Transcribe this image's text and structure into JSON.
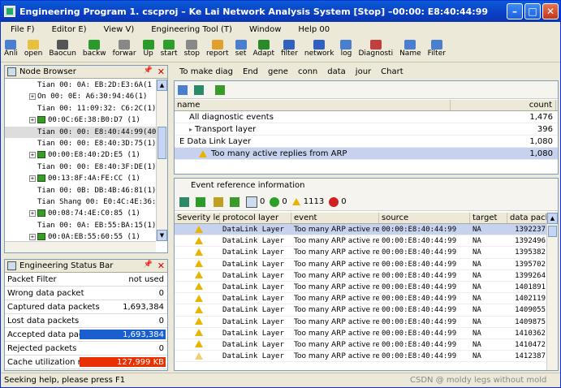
{
  "window": {
    "title": "Engineering Program 1. cscproj – Ke Lai Network Analysis System [Stop] –00:00: E8:40:44:99"
  },
  "menu": [
    "File F)",
    "Editor E)",
    "View V)",
    "Engineering Tool (T)",
    "Window",
    "Help 00"
  ],
  "toolbar": [
    {
      "label": "Anli",
      "color": "#4a7fd0"
    },
    {
      "label": "open",
      "color": "#e8c040"
    },
    {
      "label": "Baocun",
      "color": "#555"
    },
    {
      "label": "backw",
      "color": "#2a9a2a"
    },
    {
      "label": "forwar",
      "color": "#888"
    },
    {
      "label": "Up",
      "color": "#2a9a2a"
    },
    {
      "label": "start",
      "color": "#2aa02a"
    },
    {
      "label": "stop",
      "color": "#888"
    },
    {
      "label": "report",
      "color": "#e0a030"
    },
    {
      "label": "set",
      "color": "#4a7fd0"
    },
    {
      "label": "Adapt",
      "color": "#2a8a2a"
    },
    {
      "label": "filter",
      "color": "#3060c0"
    },
    {
      "label": "network",
      "color": "#3060c0"
    },
    {
      "label": "log",
      "color": "#4a7fd0"
    },
    {
      "label": "Diagnosti",
      "color": "#c04040"
    },
    {
      "label": "Name",
      "color": "#4a7fd0"
    },
    {
      "label": "Filter",
      "color": "#4a7fd0"
    }
  ],
  "node_browser": {
    "title": "Node Browser",
    "nodes": [
      {
        "text": "Tian 00: 0A: EB:2D:E3:6A(1",
        "icon": false,
        "exp": false
      },
      {
        "text": "On 00: 0E: A6:30:94:46(1)",
        "icon": false,
        "exp": true
      },
      {
        "text": "Tian 00: 11:09:32: C6:2C(1)",
        "icon": false,
        "exp": false
      },
      {
        "text": "00:0C:6E:38:B0:D7 (1)",
        "icon": true,
        "exp": true
      },
      {
        "text": "Tian 00: 00: E8:40:44:99(40)",
        "icon": false,
        "exp": false,
        "sel": true
      },
      {
        "text": "Tian 00: 00: E8:40:3D:75(1)",
        "icon": false,
        "exp": false
      },
      {
        "text": "00:00:E8:40:2D:E5 (1)",
        "icon": true,
        "exp": true
      },
      {
        "text": "Tian 00: 00: E8:40:3F:DE(1)",
        "icon": false,
        "exp": false
      },
      {
        "text": "00:13:8F:4A:FE:CC (1)",
        "icon": true,
        "exp": true
      },
      {
        "text": "Tian 00: 0B: DB:4B:46:81(1)",
        "icon": false,
        "exp": false
      },
      {
        "text": "Tian Shang 00: E0:4C:4E:36:BC(1)",
        "icon": false,
        "exp": false
      },
      {
        "text": "00:08:74:4E:C0:85 (1)",
        "icon": true,
        "exp": true
      },
      {
        "text": "Tian 00: 0A: EB:55:BA:15(1)",
        "icon": false,
        "exp": false
      },
      {
        "text": "00:0A:EB:55:60:55 (1)",
        "icon": true,
        "exp": true
      },
      {
        "text": "00:0A:EB:55:5C:88 (1)",
        "icon": true,
        "exp": true
      }
    ]
  },
  "status_bar_panel": {
    "title": "Engineering Status Bar",
    "rows": [
      {
        "label": "Packet Filter",
        "value": "not used"
      },
      {
        "label": "Wrong data packet",
        "value": "0"
      },
      {
        "label": "Captured data packets",
        "value": "1,693,384"
      },
      {
        "label": "Lost data packets",
        "value": "0"
      },
      {
        "label": "Accepted data packets",
        "value": "1,693,384",
        "bar_color": "#1a5fd0",
        "fill": 1.0
      },
      {
        "label": "Rejected packets",
        "value": "0"
      },
      {
        "label": "Cache utilization rate",
        "value": "127,999 KB",
        "bar_color": "#e83000",
        "fill": 1.0
      }
    ]
  },
  "tabs": [
    "To make  diag",
    "End",
    "gene",
    "conn",
    "data",
    "jour",
    "Chart"
  ],
  "diag": {
    "headers": {
      "name": "name",
      "count": "count"
    },
    "rows": [
      {
        "name": "All diagnostic events",
        "count": "1,476",
        "indent": 1
      },
      {
        "name": "Transport layer",
        "count": "396",
        "indent": 1,
        "exp": true
      },
      {
        "name": "E Data Link Layer",
        "count": "1,080",
        "indent": 0
      },
      {
        "name": "Too many active replies from ARP",
        "count": "1,080",
        "indent": 2,
        "warn": true,
        "sel": true
      }
    ]
  },
  "events": {
    "title": "Event reference information",
    "toolbar_counts": {
      "a": "0",
      "b": "0",
      "c": "1113",
      "d": "0"
    },
    "headers": [
      "Severity level",
      "protocol layer",
      "event",
      "source",
      "target",
      "data packet"
    ],
    "rows": [
      {
        "layer": "DataLink Layer",
        "event": "Too many ARP active replies",
        "source": "00:00:E8:40:44:99",
        "target": "NA",
        "packet": "1392237",
        "sel": true
      },
      {
        "layer": "DataLink Layer",
        "event": "Too many ARP active replies",
        "source": "00:00:E8:40:44:99",
        "target": "NA",
        "packet": "1392496"
      },
      {
        "layer": "DataLink Layer",
        "event": "Too many ARP active replies",
        "source": "00:00:E8:40:44:99",
        "target": "NA",
        "packet": "1395382"
      },
      {
        "layer": "DataLink Layer",
        "event": "Too many ARP active replies",
        "source": "00:00:E8:40:44:99",
        "target": "NA",
        "packet": "1395702"
      },
      {
        "layer": "DataLink Layer",
        "event": "Too many ARP active replies",
        "source": "00:00:E8:40:44:99",
        "target": "NA",
        "packet": "1399264"
      },
      {
        "layer": "DataLink Layer",
        "event": "Too many ARP active replies",
        "source": "00:00:E8:40:44:99",
        "target": "NA",
        "packet": "1401891"
      },
      {
        "layer": "DataLink Layer",
        "event": "Too many ARP active replies",
        "source": "00:00:E8:40:44:99",
        "target": "NA",
        "packet": "1402119"
      },
      {
        "layer": "DataLink Layer",
        "event": "Too many ARP active replies",
        "source": "00:00:E8:40:44:99",
        "target": "NA",
        "packet": "1409055"
      },
      {
        "layer": "DataLink Layer",
        "event": "Too many ARP active replies",
        "source": "00:00:E8:40:44:99",
        "target": "NA",
        "packet": "1409875"
      },
      {
        "layer": "DataLink Layer",
        "event": "Too many ARP active replies",
        "source": "00:00:E8:40:44:99",
        "target": "NA",
        "packet": "1410362"
      },
      {
        "layer": "DataLink Layer",
        "event": "Too many ARP active replies",
        "source": "00:00:E8:40:44:99",
        "target": "NA",
        "packet": "1410472"
      },
      {
        "layer": "DataLink Layer",
        "event": "Too many ARP active replies",
        "source": "00:00:E8:40:44:99",
        "target": "NA",
        "packet": "1412387",
        "outline": true
      }
    ]
  },
  "statusbar": {
    "text": "Seeking help, please press F1",
    "watermark": "CSDN @ moldy legs without mold"
  }
}
